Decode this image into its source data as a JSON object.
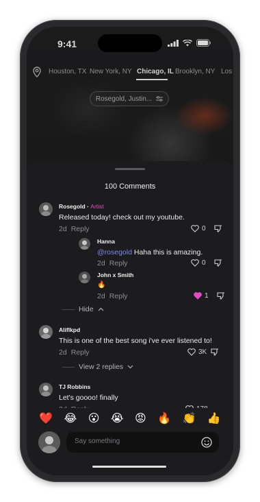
{
  "status": {
    "time": "9:41"
  },
  "cities": [
    "Houston, TX",
    "New York, NY",
    "Chicago, IL",
    "Brooklyn, NY",
    "Los A"
  ],
  "active_city": "Chicago, IL",
  "filter": {
    "label": "Rosegold, Justin..."
  },
  "sheet": {
    "title": "100 Comments"
  },
  "comments": [
    {
      "name": "Rosegold",
      "tag": "Artist",
      "text": "Released today! check out my youtube.",
      "time": "2d",
      "reply": "Reply",
      "likes": "0"
    },
    {
      "name": "Hanna",
      "mention": "@rosegold",
      "text": "Haha this is amazing.",
      "time": "2d",
      "reply": "Reply",
      "likes": "0"
    },
    {
      "name": "John x Smith",
      "text": "🔥",
      "time": "2d",
      "reply": "Reply",
      "likes": "1"
    },
    {
      "name": "Aliflkpd",
      "text": "This is one of the best song i've ever listened to!",
      "time": "2d",
      "reply": "Reply",
      "likes": "3K"
    },
    {
      "name": "TJ Robbins",
      "text": "Let's goooo! finally",
      "time": "2d",
      "reply": "Reply",
      "likes": "178"
    }
  ],
  "hide_label": "Hide",
  "view_replies_label": "View 2 replies",
  "emojis": [
    "❤️",
    "😂",
    "😮",
    "😭",
    "😡",
    "🔥",
    "👏",
    "👍"
  ],
  "input": {
    "placeholder": "Say something"
  },
  "colors": {
    "accent": "#e04bc2",
    "mention": "#7d86e8",
    "sheet_bg": "#1c1c1e"
  }
}
